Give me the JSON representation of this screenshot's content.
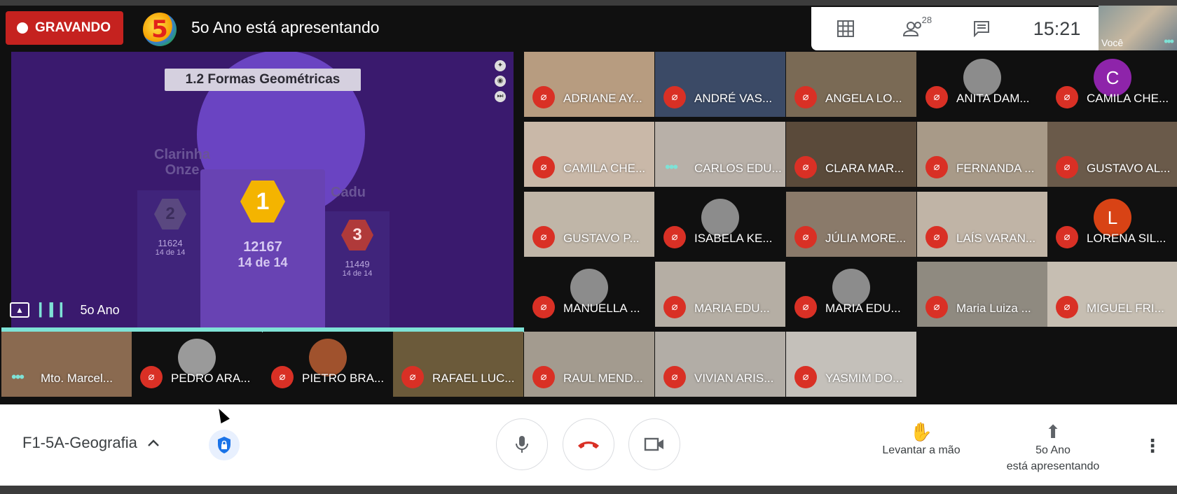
{
  "recording": {
    "label": "GRAVANDO",
    "color": "#c5221f"
  },
  "top": {
    "logo_text": "5",
    "presenting_text": "5o Ano está apresentando",
    "participants_count": "28",
    "time": "15:21",
    "self_label": "Você"
  },
  "presentation": {
    "slide_title": "1.2 Formas Geométricas",
    "first": {
      "rank": "1",
      "score": "12167",
      "detail": "14 de 14"
    },
    "second": {
      "rank": "2",
      "name_line1": "Clarinha",
      "name_line2": "Onze",
      "score": "11624",
      "detail": "14 de 14"
    },
    "third": {
      "rank": "3",
      "name": "Cadu",
      "score": "11449",
      "detail": "14 de 14"
    },
    "presenter_label": "5o Ano"
  },
  "participants": [
    {
      "name": "ADRIANE AY...",
      "bg": "#b79c80"
    },
    {
      "name": "ANDRÉ VAS...",
      "bg": "#3b4a66"
    },
    {
      "name": "ANGELA LO...",
      "bg": "#7a6a55"
    },
    {
      "name": "ANITA DAM...",
      "bg": "#101010"
    },
    {
      "name": "CAMILA CHE...",
      "bg": "#101010"
    },
    {
      "name": "CAMILA CHE...",
      "bg": "#c9b8a8"
    },
    {
      "name": "CARLOS EDU...",
      "bg": "#b8b0a8"
    },
    {
      "name": "CLARA MAR...",
      "bg": "#5a4a3a"
    },
    {
      "name": "FERNANDA ...",
      "bg": "#a89a88"
    },
    {
      "name": "GUSTAVO AL...",
      "bg": "#6a5a4a"
    },
    {
      "name": "GUSTAVO P...",
      "bg": "#c0b6a8"
    },
    {
      "name": "ISABELA KE...",
      "bg": "#101010"
    },
    {
      "name": "JÚLIA MORE...",
      "bg": "#8a7a6a"
    },
    {
      "name": "LAÍS VARAN...",
      "bg": "#c0b4a6"
    },
    {
      "name": "LORENA SIL...",
      "bg": "#101010"
    },
    {
      "name": "MANUELLA ...",
      "bg": "#101010"
    },
    {
      "name": "MARIA EDU...",
      "bg": "#b5aea4"
    },
    {
      "name": "MARIA EDU...",
      "bg": "#101010"
    },
    {
      "name": "Maria Luiza ...",
      "bg": "#8f8a80"
    },
    {
      "name": "MIGUEL FRI...",
      "bg": "#c6beb2"
    },
    {
      "name": "RAUL MEND...",
      "bg": "#a39b8f"
    },
    {
      "name": "VIVIAN ARIS...",
      "bg": "#b2ada6"
    },
    {
      "name": "YASMIM DO...",
      "bg": "#c4c0ba"
    }
  ],
  "avatars": {
    "camila": "C",
    "lorena": "L",
    "camila_color": "#8e24aa",
    "lorena_color": "#d84315"
  },
  "bottom_row": [
    {
      "name": "Mto. Marcel..."
    },
    {
      "name": "PEDRO ARA..."
    },
    {
      "name": "PIETRO BRA..."
    },
    {
      "name": "RAFAEL LUC..."
    }
  ],
  "controls": {
    "meeting_name": "F1-5A-Geografia",
    "raise_hand": "Levantar a mão",
    "presenting_line1": "5o Ano",
    "presenting_line2": "está apresentando"
  },
  "icons": {
    "grid": "grid-icon",
    "people": "people-icon",
    "chat": "chat-icon",
    "mic": "mic-icon",
    "hangup": "hangup-icon",
    "camera": "camera-icon",
    "hand": "hand-icon",
    "present": "present-icon",
    "more": "more-vert-icon",
    "shield": "shield-lock-icon",
    "chevron": "chevron-up-icon"
  }
}
